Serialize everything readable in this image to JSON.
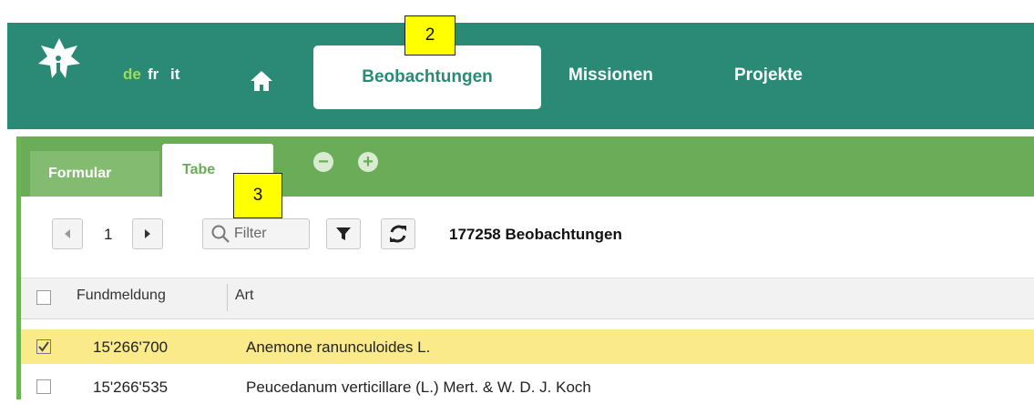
{
  "badges": {
    "b2": "2",
    "b3": "3"
  },
  "header": {
    "languages": [
      "de",
      "fr",
      "it"
    ],
    "active_language": "de",
    "nav": {
      "observations": "Beobachtungen",
      "missions": "Missionen",
      "projects": "Projekte"
    }
  },
  "subtabs": {
    "form": "Formular",
    "table": "Tabe"
  },
  "toolbar": {
    "page": "1",
    "filter_label": "Filter",
    "count_text": "177258 Beobachtungen"
  },
  "table": {
    "columns": [
      "Fundmeldung",
      "Art"
    ],
    "rows": [
      {
        "id": "15'266'700",
        "species": "Anemone ranunculoides L.",
        "checked": true
      },
      {
        "id": "15'266'535",
        "species": "Peucedanum verticillare (L.) Mert. & W. D. J. Koch",
        "checked": false
      }
    ]
  },
  "colors": {
    "header_bg": "#2a8a76",
    "accent_green": "#6aac58",
    "selected_row": "#fbea8a",
    "lang_active": "#9fdc57"
  }
}
